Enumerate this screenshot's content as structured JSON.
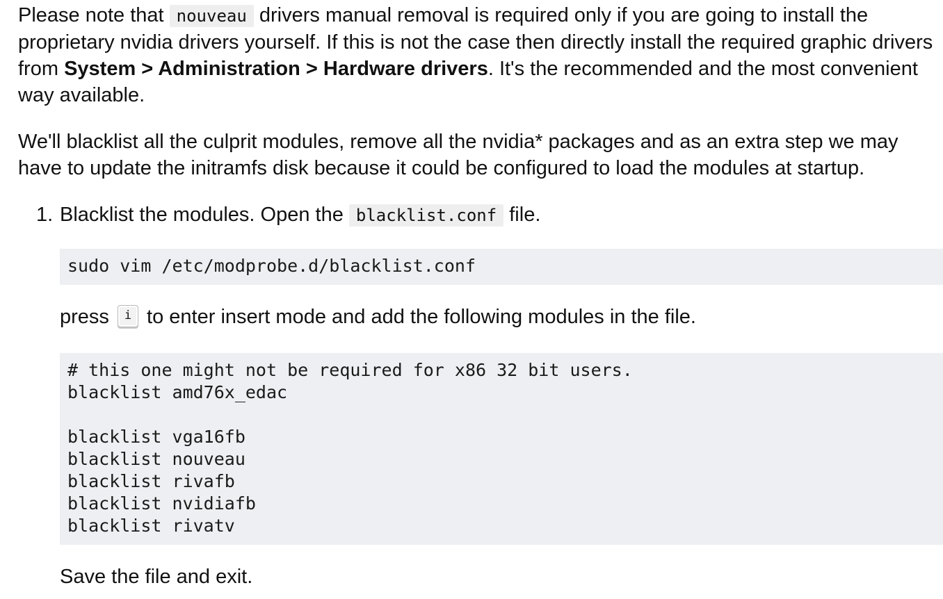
{
  "intro": {
    "before_code": "Please note that ",
    "inline_code": "nouveau",
    "after_code": " drivers manual removal is required only if you are going to install the proprietary nvidia drivers yourself. If this is not the case then directly install the required graphic drivers from ",
    "bold_path": "System > Administration > Hardware drivers",
    "after_path": ". It's the recommended and the most convenient way available."
  },
  "overview": "We'll blacklist all the culprit modules, remove all the nvidia* packages and as an extra step we may have to update the initramfs disk because it could be configured to load the modules at startup.",
  "steps": [
    {
      "number": "1.",
      "text_before_code": "Blacklist the modules. Open the ",
      "inline_code": "blacklist.conf",
      "text_after_code": " file.",
      "command": "sudo vim /etc/modprobe.d/blacklist.conf",
      "press_before": "press ",
      "key": "i",
      "press_after": " to enter insert mode and add the following modules in the file.",
      "file_content": "# this one might not be required for x86 32 bit users.\nblacklist amd76x_edac\n\nblacklist vga16fb\nblacklist nouveau\nblacklist rivafb\nblacklist nvidiafb\nblacklist rivatv",
      "closing": "Save the file and exit."
    }
  ]
}
